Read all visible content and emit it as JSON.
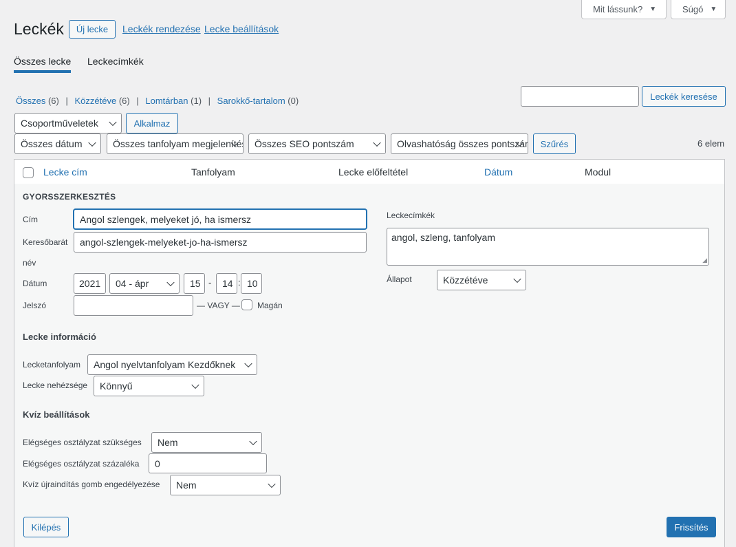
{
  "top_tabs": {
    "screen_options": "Mit lássunk?",
    "help": "Súgó"
  },
  "header": {
    "title": "Leckék",
    "new_button": "Új lecke",
    "links": [
      "Leckék rendezése",
      "Lecke beállítások"
    ]
  },
  "nav_tabs": [
    "Összes lecke",
    "Leckecímkék"
  ],
  "subsubsub": [
    {
      "label": "Összes",
      "count": "(6)"
    },
    {
      "label": "Közzétéve",
      "count": "(6)"
    },
    {
      "label": "Lomtárban",
      "count": "(1)"
    },
    {
      "label": "Sarokkő-tartalom",
      "count": "(0)"
    }
  ],
  "search": {
    "value": "",
    "button": "Leckék keresése"
  },
  "bulk": {
    "select": "Csoportműveletek",
    "apply": "Alkalmaz"
  },
  "filters": {
    "date": "Összes dátum",
    "course": "Összes tanfolyam megjelenítése",
    "seo": "Összes SEO pontszám",
    "readability": "Olvashatóság összes pontszáma",
    "filter_button": "Szűrés",
    "count": "6 elem"
  },
  "table": {
    "columns": [
      "Lecke cím",
      "Tanfolyam",
      "Lecke előfeltétel",
      "Dátum",
      "Modul"
    ]
  },
  "quick_edit": {
    "heading": "GYORSSZERKESZTÉS",
    "title_label": "Cím",
    "title_value": "Angol szlengek, melyeket jó, ha ismersz",
    "slug_label_1": "Keresőbarát",
    "slug_label_2": "név",
    "slug_value": "angol-szlengek-melyeket-jo-ha-ismersz",
    "date_label": "Dátum",
    "date": {
      "year": "2021",
      "month": "04 - ápr",
      "day": "15",
      "sep1": "-",
      "hour": "14",
      "sep2": ":",
      "minute": "10"
    },
    "password_label": "Jelszó",
    "password_value": "",
    "or_text": "— VAGY —",
    "private_label": "Magán",
    "tags_label": "Leckecímkék",
    "tags_value": "angol, szleng, tanfolyam",
    "status_label": "Állapot",
    "status_value": "Közzétéve",
    "lesson_info_heading": "Lecke információ",
    "course_label": "Lecketanfolyam",
    "course_value": "Angol nyelvtanfolyam Kezdőknek",
    "difficulty_label": "Lecke nehézsége",
    "difficulty_value": "Könnyű",
    "quiz_heading": "Kvíz beállítások",
    "pass_required_label": "Elégséges osztályzat szükséges",
    "pass_required_value": "Nem",
    "pass_percent_label": "Elégséges osztályzat százaléka",
    "pass_percent_value": "0",
    "reset_label": "Kvíz újraindítás gomb engedélyezése",
    "reset_value": "Nem",
    "cancel": "Kilépés",
    "update": "Frissítés"
  }
}
